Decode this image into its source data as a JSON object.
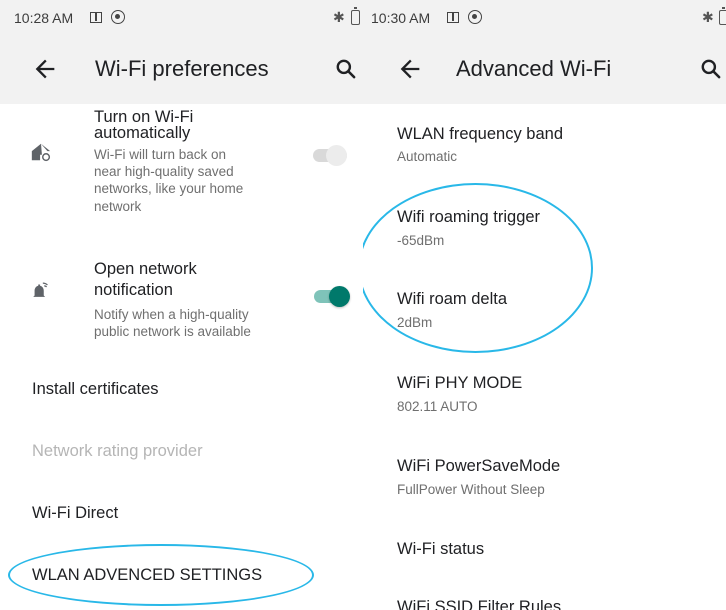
{
  "left_screen": {
    "status_time": "10:28 AM",
    "title": "Wi-Fi preferences",
    "items": [
      {
        "title_line1": "Turn on Wi-Fi",
        "title_line2": "automatically",
        "summary_lines": [
          "Wi-Fi will turn back on",
          "near high-quality saved",
          "networks, like your home",
          "network"
        ],
        "icon": "wifi-auto-home-icon",
        "toggle_on": false
      },
      {
        "title_line1": "Open network",
        "title_line2": "notification",
        "summary_lines": [
          "Notify when a high-quality",
          "public network is available"
        ],
        "icon": "wifi-notification-icon",
        "toggle_on": true
      },
      {
        "title": "Install certificates"
      },
      {
        "title": "Network rating provider",
        "disabled": true
      },
      {
        "title": "Wi-Fi Direct"
      },
      {
        "title": "WLAN ADVENCED SETTINGS",
        "highlighted": true
      }
    ]
  },
  "right_screen": {
    "status_time": "10:30 AM",
    "title": "Advanced Wi-Fi",
    "items": [
      {
        "title": "WLAN frequency band",
        "summary": "Automatic"
      },
      {
        "title": "Wifi roaming trigger",
        "summary": "-65dBm"
      },
      {
        "title": "Wifi roam delta",
        "summary": "2dBm"
      },
      {
        "title": "WiFi PHY MODE",
        "summary": "802.11 AUTO"
      },
      {
        "title": "WiFi PowerSaveMode",
        "summary": "FullPower Without Sleep"
      },
      {
        "title": "Wi-Fi status"
      },
      {
        "title": "WiFi SSID Filter Rules"
      }
    ]
  },
  "colors": {
    "accent": "#00796b",
    "highlight_ring": "#29b8e8",
    "toolbar_bg": "#f2f2f2"
  }
}
